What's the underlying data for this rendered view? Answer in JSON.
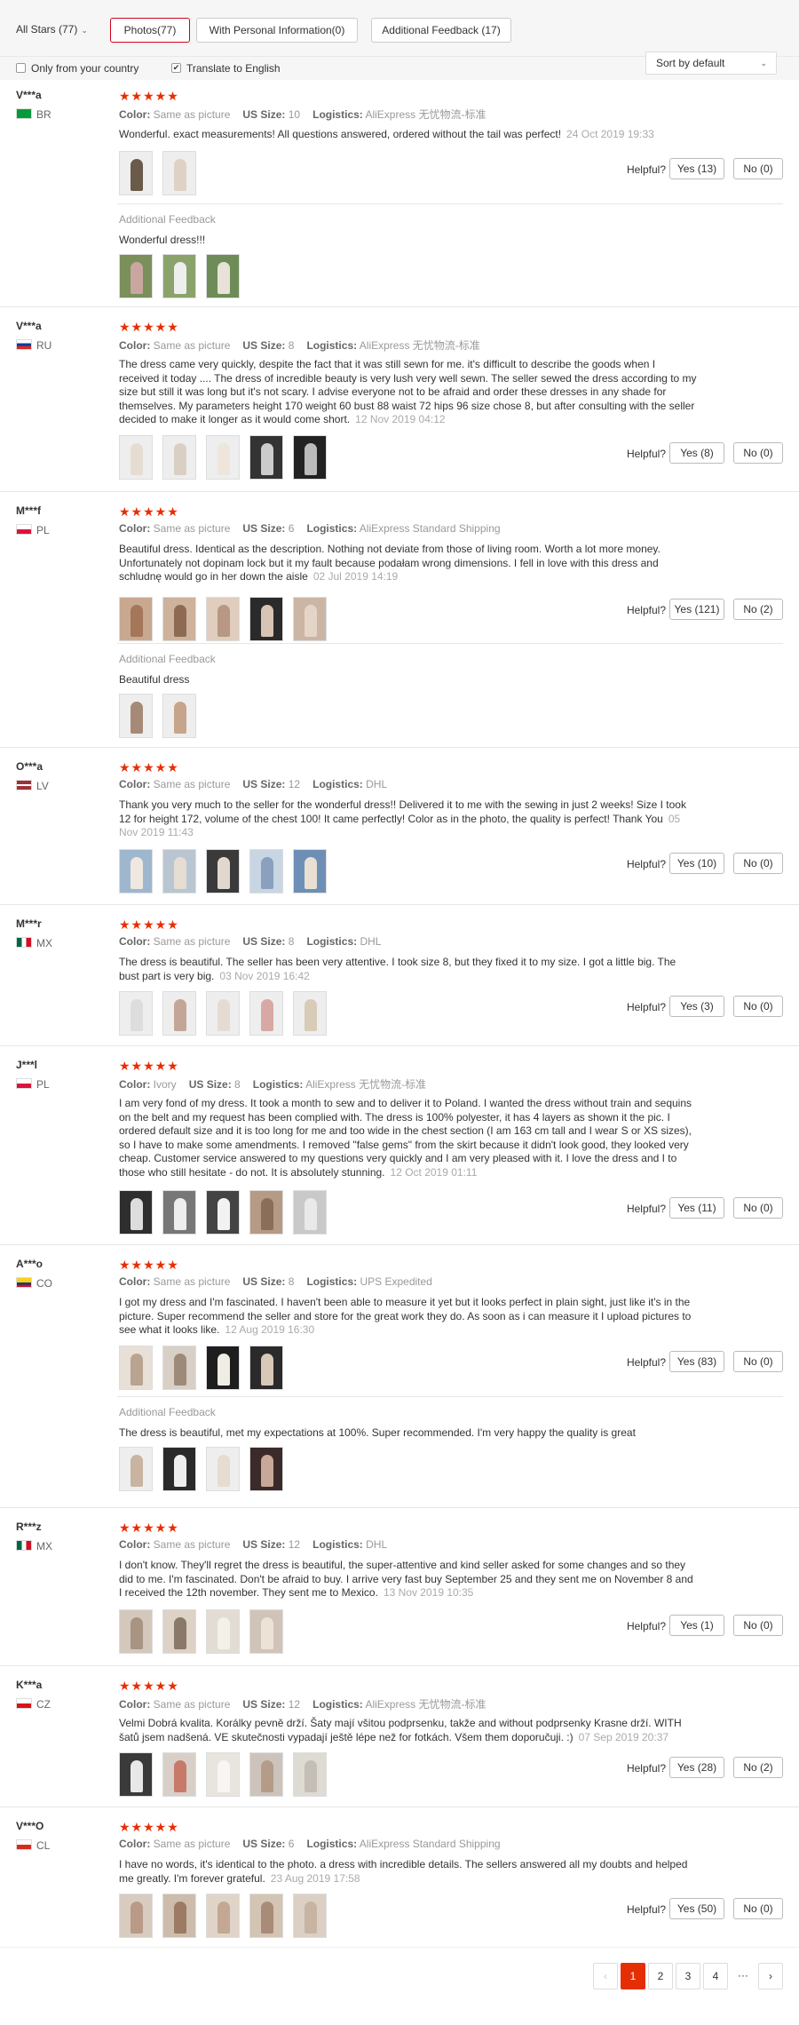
{
  "filters": {
    "all_stars": "All Stars (77)",
    "photos": "Photos(77)",
    "personal": "With Personal Information(0)",
    "additional": "Additional Feedback (17)",
    "only_country": "Only from your country",
    "translate": "Translate to English",
    "sort": "Sort by default"
  },
  "labels": {
    "color": "Color:",
    "size": "US Size:",
    "logistics": "Logistics:",
    "helpful": "Helpful?",
    "additional_feedback": "Additional Feedback",
    "stars": "★★★★★"
  },
  "reviews": [
    {
      "name": "V***a",
      "country": "BR",
      "color": "Same as picture",
      "size": "10",
      "logistics": "AliExpress 无忧物流-标准",
      "text": "Wonderful. exact measurements! All questions answered, ordered without the tail was perfect!",
      "date": "24 Oct 2019 19:33",
      "yes": "Yes (13)",
      "no": "No (0)",
      "af_text": "Wonderful dress!!!"
    },
    {
      "name": "V***a",
      "country": "RU",
      "color": "Same as picture",
      "size": "8",
      "logistics": "AliExpress 无忧物流-标准",
      "text": "The dress came very quickly, despite the fact that it was still sewn for me. it's difficult to describe the goods when I received it today .... The dress of incredible beauty is very lush very well sewn. The seller sewed the dress according to my size but still it was long but it's not scary. I advise everyone not to be afraid and order these dresses in any shade for themselves. My parameters height 170 weight 60 bust 88 waist 72 hips 96 size chose 8, but after consulting with the seller decided to make it longer as it would come short.",
      "date": "12 Nov 2019 04:12",
      "yes": "Yes (8)",
      "no": "No (0)"
    },
    {
      "name": "M***f",
      "country": "PL",
      "color": "Same as picture",
      "size": "6",
      "logistics": "AliExpress Standard Shipping",
      "text": "Beautiful dress. Identical as the description. Nothing not deviate from those of living room. Worth a lot more money. Unfortunately not dopinam lock but it my fault because podałam wrong dimensions. I fell in love with this dress and schludnę would go in her down the aisle",
      "date": "02 Jul 2019 14:19",
      "yes": "Yes (121)",
      "no": "No (2)",
      "af_text": "Beautiful dress"
    },
    {
      "name": "O***a",
      "country": "LV",
      "color": "Same as picture",
      "size": "12",
      "logistics": "DHL",
      "text": "Thank you very much to the seller for the wonderful dress!! Delivered it to me with the sewing in just 2 weeks! Size I took 12 for height 172, volume of the chest 100! It came perfectly! Color as in the photo, the quality is perfect! Thank You",
      "date": "05 Nov 2019 11:43",
      "yes": "Yes (10)",
      "no": "No (0)"
    },
    {
      "name": "M***r",
      "country": "MX",
      "color": "Same as picture",
      "size": "8",
      "logistics": "DHL",
      "text": "The dress is beautiful. The seller has been very attentive. I took size 8, but they fixed it to my size. I got a little big. The bust part is very big.",
      "date": "03 Nov 2019 16:42",
      "yes": "Yes (3)",
      "no": "No (0)"
    },
    {
      "name": "J***l",
      "country": "PL",
      "color": "Ivory",
      "size": "8",
      "logistics": "AliExpress 无忧物流-标准",
      "text": "I am very fond of my dress. It took a month to sew and to deliver it to Poland. I wanted the dress without train and sequins on the belt and my request has been complied with. The dress is 100% polyester, it has 4 layers as shown it the pic. I ordered default size and it is too long for me and too wide in the chest section (I am 163 cm tall and I wear S or XS sizes), so I have to make some amendments. I removed \"false gems\" from the skirt because it didn't look good, they looked very cheap. Customer service answered to my questions very quickly and I am very pleased with it. I love the dress and I to those who still hesitate - do not. It is absolutely stunning.",
      "date": "12 Oct 2019 01:11",
      "yes": "Yes (11)",
      "no": "No (0)"
    },
    {
      "name": "A***o",
      "country": "CO",
      "color": "Same as picture",
      "size": "8",
      "logistics": "UPS Expedited",
      "text": "I got my dress and I'm fascinated. I haven't been able to measure it yet but it looks perfect in plain sight, just like it's in the picture. Super recommend the seller and store for the great work they do. As soon as i can measure it I upload pictures to see what it looks like.",
      "date": "12 Aug 2019 16:30",
      "yes": "Yes (83)",
      "no": "No (0)",
      "af_text": "The dress is beautiful, met my expectations at 100%. Super recommended. I'm very happy the quality is great"
    },
    {
      "name": "R***z",
      "country": "MX",
      "color": "Same as picture",
      "size": "12",
      "logistics": "DHL",
      "text": "I don't know. They'll regret the dress is beautiful, the super-attentive and kind seller asked for some changes and so they did to me. I'm fascinated. Don't be afraid to buy. I arrive very fast buy September 25 and they sent me on November 8 and I received the 12th november. They sent me to Mexico.",
      "date": "13 Nov 2019 10:35",
      "yes": "Yes (1)",
      "no": "No (0)"
    },
    {
      "name": "K***a",
      "country": "CZ",
      "color": "Same as picture",
      "size": "12",
      "logistics": "AliExpress 无忧物流-标准",
      "text": "Velmi Dobrá kvalita. Korálky pevně drží. Šaty mají všitou podprsenku, takže and without podprsenky Krasne drží. WITH šatů jsem nadšená. VE skutečnosti vypadají ještě lépe než for fotkách. Všem them doporučuji. :)",
      "date": "07 Sep 2019 20:37",
      "yes": "Yes (28)",
      "no": "No (2)"
    },
    {
      "name": "V***O",
      "country": "CL",
      "color": "Same as picture",
      "size": "6",
      "logistics": "AliExpress Standard Shipping",
      "text": "I have no words, it's identical to the photo. a dress with incredible details. The sellers answered all my doubts and helped me greatly. I'm forever grateful.",
      "date": "23 Aug 2019 17:58",
      "yes": "Yes (50)",
      "no": "No (0)"
    }
  ],
  "pagination": {
    "prev": "‹",
    "p1": "1",
    "p2": "2",
    "p3": "3",
    "p4": "4",
    "dots": "···",
    "next": "›"
  },
  "colors": {
    "accent": "#e62e04",
    "active_border": "#d0021b"
  }
}
